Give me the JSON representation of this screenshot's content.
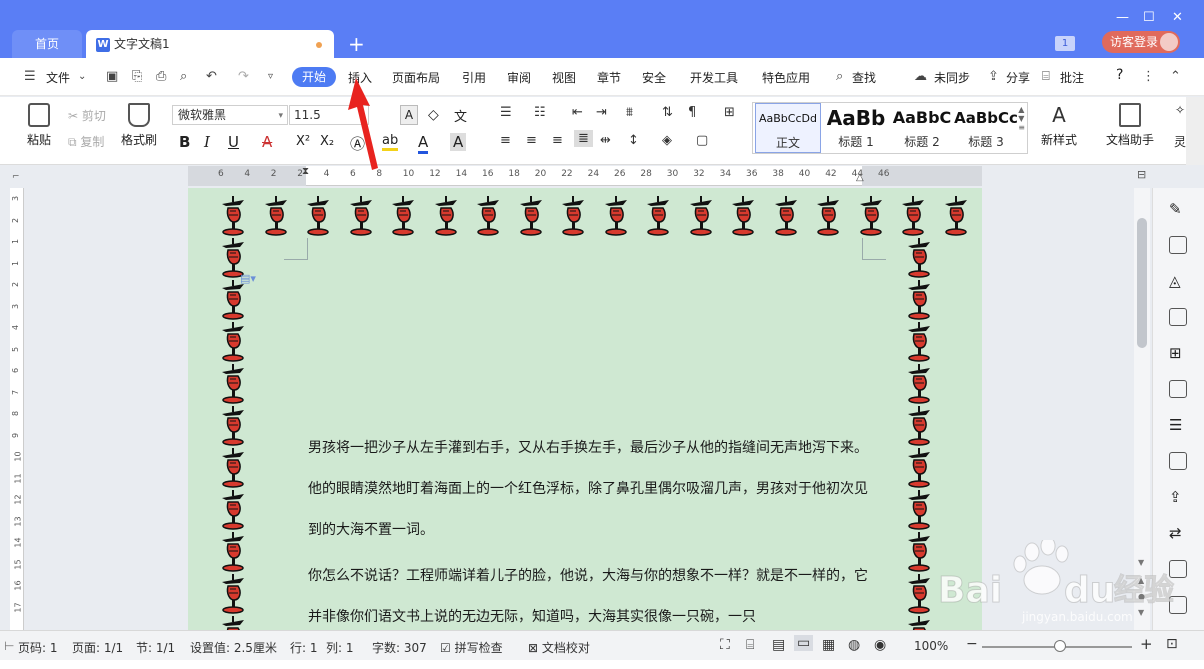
{
  "titlebar": {
    "home_tab": "首页",
    "doc_tab": "文字文稿1",
    "new_tab": "+",
    "badge": "1",
    "guest_login": "访客登录"
  },
  "menubar": {
    "file": "文件",
    "tabs": [
      "开始",
      "插入",
      "页面布局",
      "引用",
      "审阅",
      "视图",
      "章节",
      "安全",
      "开发工具",
      "特色应用"
    ],
    "search": "查找",
    "sync": "未同步",
    "share": "分享",
    "comment": "批注",
    "help": "?"
  },
  "toolbar": {
    "paste": "粘贴",
    "cut": "剪切",
    "copy": "复制",
    "format_painter": "格式刷",
    "font_name": "微软雅黑",
    "font_size": "11.5",
    "bold": "B",
    "italic": "I",
    "underline": "U",
    "strike": "A",
    "superscript": "X²",
    "subscript": "X₂",
    "styles": [
      {
        "preview": "AaBbCcDd",
        "name": "正文"
      },
      {
        "preview": "AaBb",
        "name": "标题 1"
      },
      {
        "preview": "AaBbC",
        "name": "标题 2"
      },
      {
        "preview": "AaBbCc",
        "name": "标题 3"
      }
    ],
    "new_style": "新样式",
    "doc_assistant": "文档助手",
    "more": "灵"
  },
  "ruler": {
    "h_ticks": [
      "6",
      "4",
      "2",
      "2",
      "4",
      "6",
      "8",
      "10",
      "12",
      "14",
      "16",
      "18",
      "20",
      "22",
      "24",
      "26",
      "28",
      "30",
      "32",
      "34",
      "36",
      "38",
      "40",
      "42",
      "44",
      "46"
    ],
    "v_ticks": [
      "3",
      "2",
      "1",
      "1",
      "2",
      "3",
      "4",
      "5",
      "6",
      "7",
      "8",
      "9",
      "10",
      "11",
      "12",
      "13",
      "14",
      "15",
      "16",
      "17"
    ]
  },
  "document": {
    "para1": "男孩将一把沙子从左手灌到右手，又从右手换左手，最后沙子从他的指缝间无声地泻下来。他的眼睛漠然地盯着海面上的一个红色浮标，除了鼻孔里偶尔吸溜几声，男孩对于他初次见到的大海不置一词。",
    "para2": "你怎么不说话？工程师端详着儿子的脸，他说，大海与你的想象不一样？就是不一样的，它并非像你们语文书上说的无边无际，知道吗，大海其实很像一只碗，一只"
  },
  "statusbar": {
    "page_num": "页码: 1",
    "pages": "页面: 1/1",
    "section": "节: 1/1",
    "setting": "设置值: 2.5厘米",
    "row": "行: 1",
    "col": "列: 1",
    "word_count": "字数: 307",
    "spell_check": "拼写检查",
    "doc_check": "文档校对",
    "zoom": "100%"
  },
  "watermark": {
    "brand": "Bai du 经验",
    "url": "jingyan.baidu.com"
  },
  "colors": {
    "titlebar": "#5a7ef5",
    "accent": "#4d7bf3",
    "page_bg": "#cfe8d2",
    "arrow": "#e8231f"
  }
}
